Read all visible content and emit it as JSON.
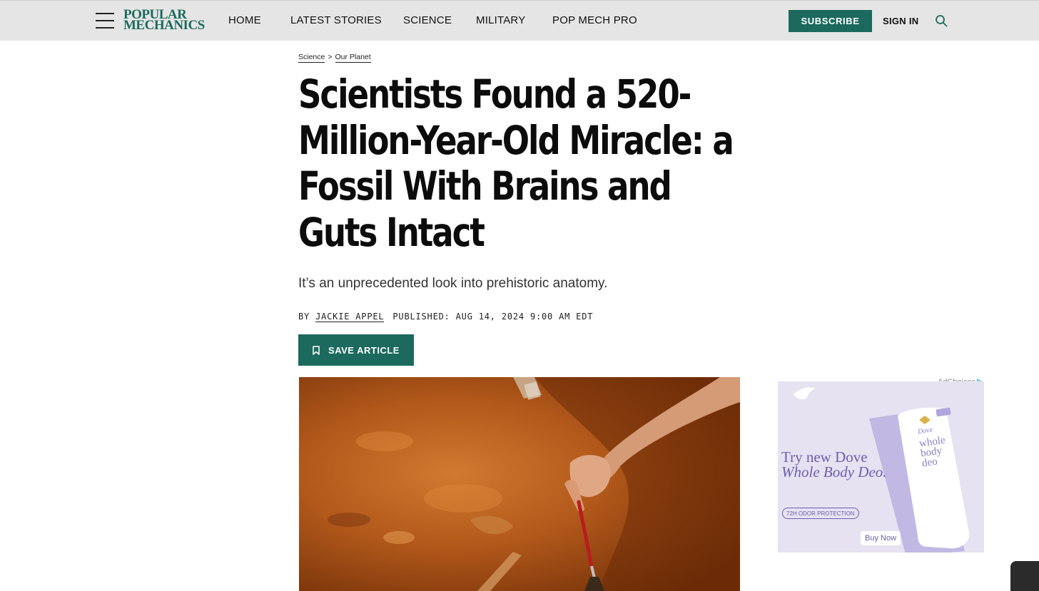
{
  "header": {
    "logo_line1": "POPULAR",
    "logo_line2": "MECHANICS",
    "nav": [
      "HOME",
      "LATEST STORIES",
      "SCIENCE",
      "MILITARY",
      "POP MECH PRO"
    ],
    "subscribe_label": "SUBSCRIBE",
    "signin_label": "SIGN IN"
  },
  "breadcrumb": {
    "items": [
      "Science",
      "Our Planet"
    ],
    "separator": ">"
  },
  "article": {
    "headline_lines": [
      "Scientists Found a 520-",
      "Million-Year-Old Miracle: a",
      "Fossil With Brains and",
      "Guts Intact"
    ],
    "dek": "It’s an unprecedented look into prehistoric anatomy.",
    "byline_prefix": "BY",
    "author": "JACKIE APPEL",
    "published": "PUBLISHED: AUG 14, 2024 9:00 AM EDT",
    "save_label": "SAVE ARTICLE"
  },
  "ad": {
    "adchoices_label": "AdChoices",
    "headline_line1": "Try new Dove",
    "headline_line2": "Whole Body Deo.",
    "badge": "72H ODOR PROTECTION",
    "product_brand": "Dove",
    "product_name": [
      "whole",
      "body",
      "deo"
    ],
    "cta": "Buy Now"
  },
  "colors": {
    "brand": "#1b6a5d",
    "header_bg": "#e5e5e5",
    "ad_accent": "#6b5fb0"
  }
}
